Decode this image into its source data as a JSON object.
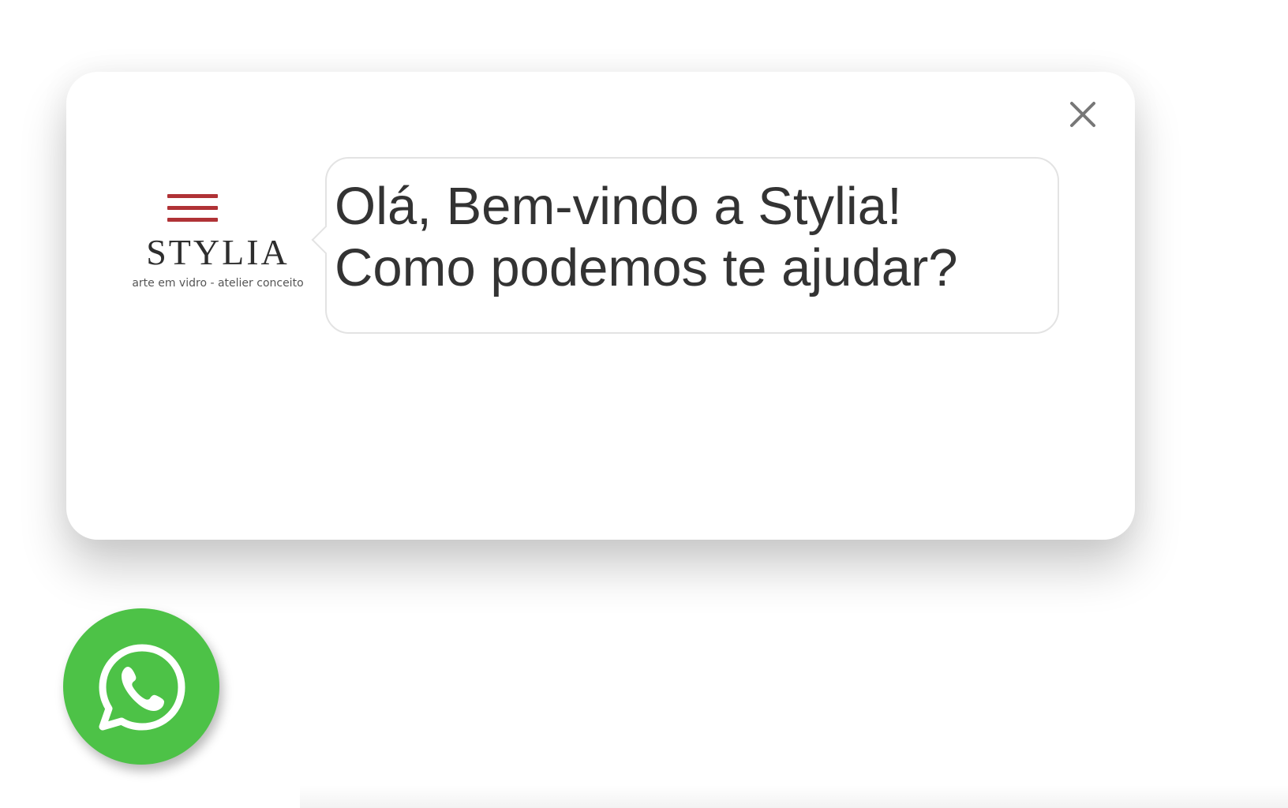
{
  "popup": {
    "close_icon": "close-icon",
    "logo": {
      "brand": "STYLIA",
      "tagline": "arte em vidro - atelier conceito",
      "accent_color": "#b03236"
    },
    "message": {
      "line1": "Olá, Bem-vindo a Stylia!",
      "line2": "Como podemos te ajudar?"
    }
  },
  "whatsapp_button": {
    "icon": "whatsapp-icon",
    "color": "#4dc247"
  }
}
